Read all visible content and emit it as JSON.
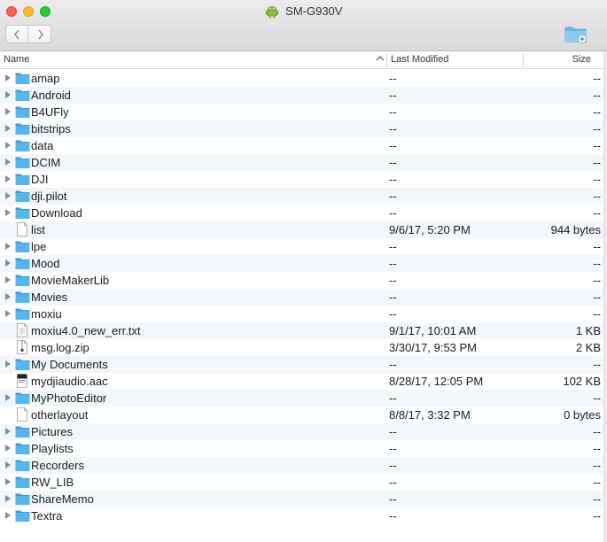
{
  "window": {
    "title": "SM-G930V"
  },
  "columns": {
    "name": "Name",
    "modified": "Last Modified",
    "size": "Size"
  },
  "rows": [
    {
      "name": "amap",
      "modified": "--",
      "size": "--",
      "type": "folder"
    },
    {
      "name": "Android",
      "modified": "--",
      "size": "--",
      "type": "folder"
    },
    {
      "name": "B4UFly",
      "modified": "--",
      "size": "--",
      "type": "folder"
    },
    {
      "name": "bitstrips",
      "modified": "--",
      "size": "--",
      "type": "folder"
    },
    {
      "name": "data",
      "modified": "--",
      "size": "--",
      "type": "folder"
    },
    {
      "name": "DCIM",
      "modified": "--",
      "size": "--",
      "type": "folder"
    },
    {
      "name": "DJI",
      "modified": "--",
      "size": "--",
      "type": "folder"
    },
    {
      "name": "dji.pilot",
      "modified": "--",
      "size": "--",
      "type": "folder"
    },
    {
      "name": "Download",
      "modified": "--",
      "size": "--",
      "type": "folder"
    },
    {
      "name": "list",
      "modified": "9/6/17, 5:20 PM",
      "size": "944 bytes",
      "type": "file"
    },
    {
      "name": "lpe",
      "modified": "--",
      "size": "--",
      "type": "folder"
    },
    {
      "name": "Mood",
      "modified": "--",
      "size": "--",
      "type": "folder"
    },
    {
      "name": "MovieMakerLib",
      "modified": "--",
      "size": "--",
      "type": "folder"
    },
    {
      "name": "Movies",
      "modified": "--",
      "size": "--",
      "type": "folder"
    },
    {
      "name": "moxiu",
      "modified": "--",
      "size": "--",
      "type": "folder"
    },
    {
      "name": "moxiu4.0_new_err.txt",
      "modified": "9/1/17, 10:01 AM",
      "size": "1 KB",
      "type": "text"
    },
    {
      "name": "msg.log.zip",
      "modified": "3/30/17, 9:53 PM",
      "size": "2 KB",
      "type": "zip"
    },
    {
      "name": "My Documents",
      "modified": "--",
      "size": "--",
      "type": "folder"
    },
    {
      "name": "mydjiaudio.aac",
      "modified": "8/28/17, 12:05 PM",
      "size": "102 KB",
      "type": "audio"
    },
    {
      "name": "MyPhotoEditor",
      "modified": "--",
      "size": "--",
      "type": "folder"
    },
    {
      "name": "otherlayout",
      "modified": "8/8/17, 3:32 PM",
      "size": "0 bytes",
      "type": "file"
    },
    {
      "name": "Pictures",
      "modified": "--",
      "size": "--",
      "type": "folder"
    },
    {
      "name": "Playlists",
      "modified": "--",
      "size": "--",
      "type": "folder"
    },
    {
      "name": "Recorders",
      "modified": "--",
      "size": "--",
      "type": "folder"
    },
    {
      "name": "RW_LIB",
      "modified": "--",
      "size": "--",
      "type": "folder"
    },
    {
      "name": "ShareMemo",
      "modified": "--",
      "size": "--",
      "type": "folder"
    },
    {
      "name": "Textra",
      "modified": "--",
      "size": "--",
      "type": "folder"
    }
  ],
  "icons": {
    "window_icon": "android-icon",
    "back": "chevron-left-icon",
    "forward": "chevron-right-icon",
    "new_folder": "new-folder-icon",
    "sort": "sort-ascending-icon"
  },
  "colors": {
    "folder": "#5ab4ec",
    "folder_dark": "#3f9ad6",
    "row_alt": "#f3f6fa"
  }
}
